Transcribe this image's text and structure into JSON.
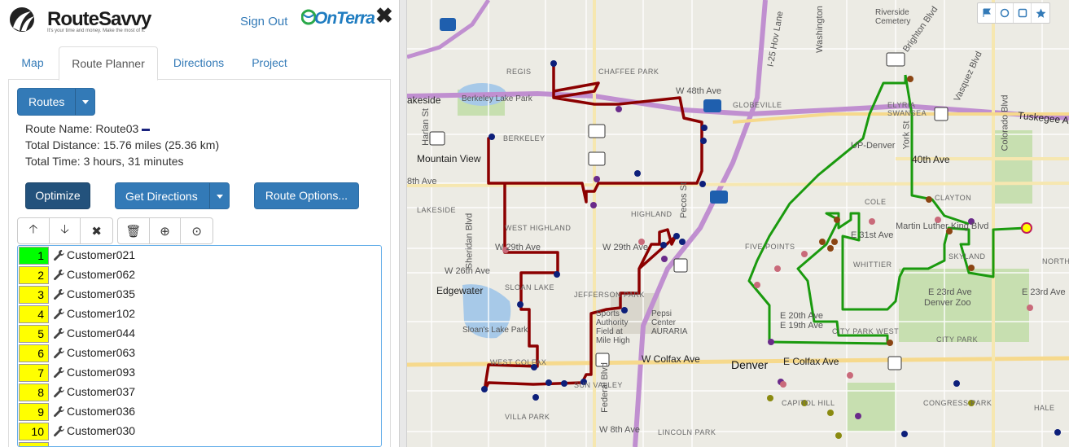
{
  "header": {
    "logo_text": "RouteSavvy",
    "logo_tagline": "It's your time and money. Make the most of it.",
    "signout_label": "Sign Out",
    "onterra_text": "OnTerra",
    "close_glyph": "✖"
  },
  "tabs": [
    {
      "label": "Map"
    },
    {
      "label": "Route Planner"
    },
    {
      "label": "Directions"
    },
    {
      "label": "Project"
    }
  ],
  "routes_button": "Routes",
  "route_info": {
    "name": "Route Name: Route03",
    "distance": "Total Distance: 15.76 miles (25.36 km)",
    "time": "Total Time: 3 hours, 31 minutes",
    "route_color": "#1a237e"
  },
  "actions": {
    "optimize": "Optimize",
    "get_directions": "Get Directions",
    "route_options": "Route Options..."
  },
  "toolbar": {
    "move_up": "🡡",
    "move_down": "🡣",
    "remove": "✖",
    "delete": "🗑",
    "zoom": "⊕",
    "download": "⊙"
  },
  "stops": [
    {
      "num": "1",
      "name": "Customer021"
    },
    {
      "num": "2",
      "name": "Customer062"
    },
    {
      "num": "3",
      "name": "Customer035"
    },
    {
      "num": "4",
      "name": "Customer102"
    },
    {
      "num": "5",
      "name": "Customer044"
    },
    {
      "num": "6",
      "name": "Customer063"
    },
    {
      "num": "7",
      "name": "Customer093"
    },
    {
      "num": "8",
      "name": "Customer037"
    },
    {
      "num": "9",
      "name": "Customer036"
    },
    {
      "num": "10",
      "name": "Customer030"
    },
    {
      "num": "",
      "name": ""
    }
  ],
  "map": {
    "controls": [
      "flag-icon",
      "circle-icon",
      "square-icon",
      "star-icon"
    ],
    "labels": {
      "regis": "REGIS",
      "chaffee": "CHAFFEE PARK",
      "globeville": "GLOBEVILLE",
      "berkeley": "BERKELEY",
      "berkeley_lake": "Berkeley Lake Park",
      "lakeside": "akeside",
      "mountain_view": "Mountain View",
      "w48": "W 48th Ave",
      "w38": "8th Ave",
      "lakeside2": "LAKESIDE",
      "west_highland": "WEST HIGHLAND",
      "highland": "HIGHLAND",
      "w29": "W 29th Ave",
      "w26": "W 26th Ave",
      "w29b": "W 29th Ave",
      "edgewater": "Edgewater",
      "sloan": "SLOAN LAKE",
      "sloans_park": "Sloan's Lake Park",
      "jefferson": "JEFFERSON PARK",
      "west_colfax": "WEST COLFAX",
      "sun_valley": "SUN VALLEY",
      "vicca": "VILLA PARK",
      "w8": "W 8th Ave",
      "lincoln": "LINCOLN PARK",
      "auraria": "Pepsi Center AURARIA",
      "sports": "Sports Authority Field at Mile High",
      "colfax": "W Colfax Ave",
      "denver": "Denver",
      "e_colfax": "E Colfax Ave",
      "capitol": "CAPITOL HILL",
      "five_points": "FIVE POINTS",
      "whittier": "WHITTIER",
      "cole": "COLE",
      "clayton": "CLAYTON",
      "skyland": "SKYLAND",
      "mlk": "Martin Luther King Blvd",
      "e31": "E 31st Ave",
      "e23": "E 23rd Ave",
      "e23b": "E 23rd Ave",
      "denver_zoo": "Denver Zoo",
      "city_park": "CITY PARK",
      "city_park_west": "CITY PARK WEST",
      "congress": "CONGRESS PARK",
      "hale": "HALE",
      "north": "NORTH",
      "e40": "40th Ave",
      "up_denver": "UP-Denver",
      "elyria": "ELYRIA SWANSEA",
      "tuskegee": "Tuskegee Ai",
      "riverside": "Riverside Cemetery",
      "brighton": "Brighton Blvd",
      "vasquez": "Vasquez Blvd",
      "colorado": "Colorado Blvd",
      "york": "York St",
      "i25": "I-25 Hov Lane",
      "washington": "Washington",
      "e20": "E 20th Ave",
      "e19": "E 19th Ave",
      "pecos": "Pecos St",
      "federal": "Federal Blvd",
      "sheridan": "Sheridan Blvd",
      "harlan": "Harlan St"
    }
  },
  "colors": {
    "brand_blue": "#337ab7",
    "route_red": "#8b0000",
    "route_green": "#1a9a0e",
    "stop_first": "#00ff00",
    "stop": "#ffff00"
  }
}
